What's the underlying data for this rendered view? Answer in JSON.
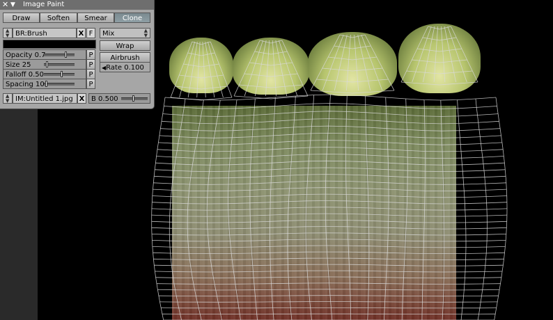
{
  "panel": {
    "title": "Image Paint",
    "tabs": [
      {
        "label": "Draw",
        "active": false
      },
      {
        "label": "Soften",
        "active": false
      },
      {
        "label": "Smear",
        "active": false
      },
      {
        "label": "Clone",
        "active": true
      }
    ],
    "brush": {
      "label": "BR:Brush",
      "close": "X",
      "fake_user": "F"
    },
    "blend_mode": "Mix",
    "sliders": [
      {
        "label": "Opacity 0.7",
        "value": 0.7,
        "pressure": "P"
      },
      {
        "label": "Size 25",
        "value": 0.25,
        "pressure": "P"
      },
      {
        "label": "Falloff 0.50",
        "value": 0.5,
        "pressure": "P"
      },
      {
        "label": "Spacing 10.",
        "value": 0.1,
        "pressure": "P"
      }
    ],
    "wrap_label": "Wrap",
    "airbrush_label": "Airbrush",
    "rate_label": "Rate 0.100",
    "image": {
      "label": "IM:Untitled 1.jpg",
      "close": "X"
    },
    "blend": {
      "label": "B 0.500",
      "value": 0.5
    }
  },
  "colors": {
    "panel_bg": "#a6a6a6",
    "titlebar": "#6e6e6e",
    "active_tab": "#7f9097",
    "mesh": "#d8d8d8"
  }
}
